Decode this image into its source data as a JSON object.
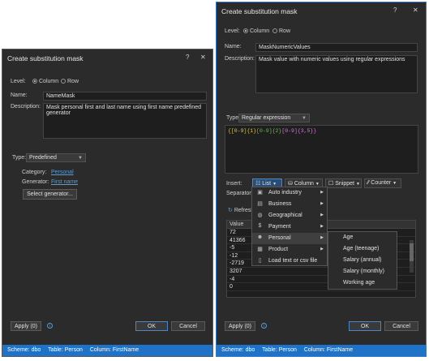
{
  "left": {
    "title": "Create substitution mask",
    "help": "?",
    "close": "✕",
    "level_label": "Level:",
    "level_column": "Column",
    "level_row": "Row",
    "name_label": "Name:",
    "name_value": "NameMask",
    "description_label": "Description:",
    "description_value": "Mask personal first and last name using first name predefined generator",
    "type_label": "Type:",
    "type_value": "Predefined",
    "category_label": "Category:",
    "category_value": "Personal",
    "generator_label": "Generator:",
    "generator_value": "First name",
    "select_generator": "Select generator...",
    "apply": "Apply (0)",
    "ok": "OK",
    "cancel": "Cancel",
    "status": {
      "scheme": "Scheme: dbo",
      "table": "Table: Person",
      "column": "Column: FirstName"
    }
  },
  "right": {
    "title": "Create substitution mask",
    "help": "?",
    "close": "✕",
    "level_label": "Level:",
    "level_column": "Column",
    "level_row": "Row",
    "name_label": "Name:",
    "name_value": "MaskNumericValues",
    "description_label": "Description:",
    "description_value": "Mask value with numeric values using regular expressions",
    "type_label": "Type:",
    "type_value": "Regular expression",
    "regex_tokens": [
      "{[0-9]{1}",
      "[0-9]{2}",
      "[0-9]{3,5}}"
    ],
    "insert_label": "Insert:",
    "insert_list": "List",
    "insert_column": "Column",
    "insert_snippet": "Snippet",
    "insert_counter": "Counter",
    "separator_label": "Separator",
    "refresh": "Refresh",
    "value_header": "Value",
    "values": [
      "72",
      "41366",
      "-5",
      "-12",
      "-2719",
      "3207",
      "-4",
      "0"
    ],
    "menu": [
      "Auto industry",
      "Business",
      "Geographical",
      "Payment",
      "Personal",
      "Product",
      "Load text or csv file"
    ],
    "submenu": [
      "Age",
      "Age (teenage)",
      "Salary (annual)",
      "Salary (monthly)",
      "Working age"
    ],
    "apply": "Apply (0)",
    "ok": "OK",
    "cancel": "Cancel",
    "status": {
      "scheme": "Scheme: dbo",
      "table": "Table: Person",
      "column": "Column: FirstName"
    }
  },
  "colors": {
    "accent": "#1e73c8",
    "link": "#5b9bd5",
    "background": "#2b2b2b"
  }
}
